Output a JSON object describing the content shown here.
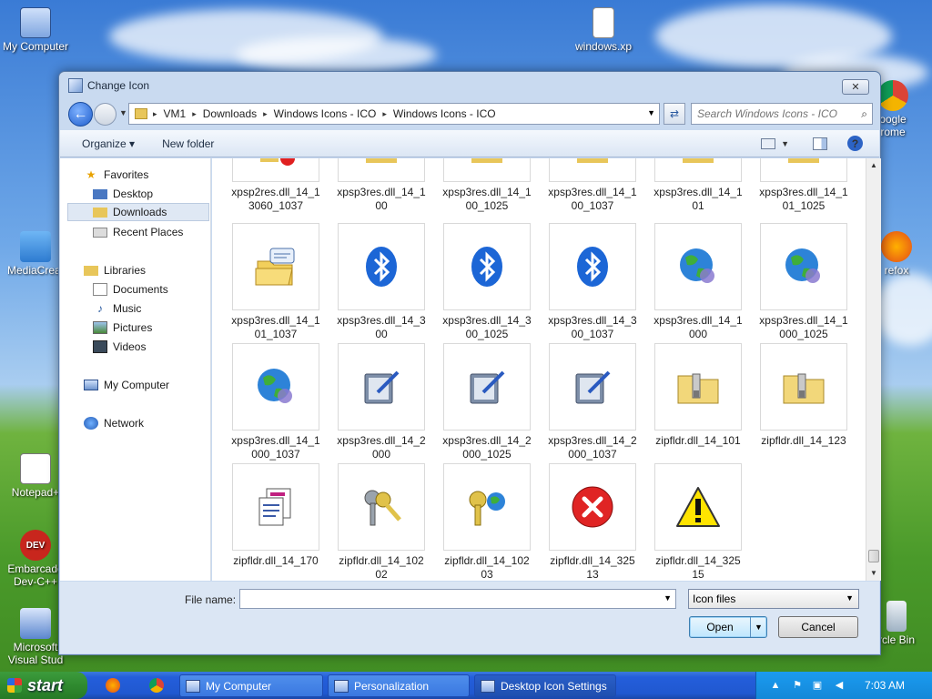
{
  "desktop": {
    "icons": [
      {
        "name": "my-computer",
        "label": "My Computer"
      },
      {
        "name": "windows-xp",
        "label": "windows.xp"
      },
      {
        "name": "google-chrome",
        "label_line1": "oogle",
        "label_line2": "rome"
      },
      {
        "name": "mediacreation",
        "label": "MediaCreat"
      },
      {
        "name": "firefox",
        "label": "refox"
      },
      {
        "name": "notepad",
        "label": "Notepad+"
      },
      {
        "name": "embarcadero",
        "label_line1": "Embarcade",
        "label_line2": "Dev-C++",
        "badge": "DEV"
      },
      {
        "name": "visual-studio",
        "label_line1": "Microsoft",
        "label_line2": "Visual Stud"
      },
      {
        "name": "recycle-bin",
        "label": "rcle Bin"
      }
    ]
  },
  "dialog": {
    "title": "Change Icon",
    "close_glyph": "✕",
    "breadcrumb": [
      "VM1",
      "Downloads",
      "Windows Icons - ICO",
      "Windows Icons - ICO"
    ],
    "search_placeholder": "Search Windows Icons - ICO",
    "toolbar": {
      "organize": "Organize ▾",
      "new_folder": "New folder",
      "help": "?"
    },
    "nav": {
      "favorites": "Favorites",
      "desktop": "Desktop",
      "downloads": "Downloads",
      "recent": "Recent Places",
      "libraries": "Libraries",
      "documents": "Documents",
      "music": "Music",
      "pictures": "Pictures",
      "videos": "Videos",
      "my_computer": "My Computer",
      "network": "Network"
    },
    "files_row0": [
      {
        "name": "xpsp2res.dll_14_13060_1037",
        "lines": [
          "xpsp2res.dll_14_1",
          "3060_1037"
        ]
      },
      {
        "name": "xpsp3res.dll_14_100",
        "lines": [
          "xpsp3res.dll_14_1",
          "00"
        ]
      },
      {
        "name": "xpsp3res.dll_14_100_1025",
        "lines": [
          "xpsp3res.dll_14_1",
          "00_1025"
        ]
      },
      {
        "name": "xpsp3res.dll_14_100_1037",
        "lines": [
          "xpsp3res.dll_14_1",
          "00_1037"
        ]
      },
      {
        "name": "xpsp3res.dll_14_101",
        "lines": [
          "xpsp3res.dll_14_1",
          "01"
        ]
      },
      {
        "name": "xpsp3res.dll_14_101_1025",
        "lines": [
          "xpsp3res.dll_14_1",
          "01_1025"
        ]
      }
    ],
    "files_row1": [
      {
        "lines": [
          "xpsp3res.dll_14_1",
          "01_1037"
        ],
        "icon": "folder-chat-icon"
      },
      {
        "lines": [
          "xpsp3res.dll_14_3",
          "00"
        ],
        "icon": "bluetooth-icon"
      },
      {
        "lines": [
          "xpsp3res.dll_14_3",
          "00_1025"
        ],
        "icon": "bluetooth-icon"
      },
      {
        "lines": [
          "xpsp3res.dll_14_3",
          "00_1037"
        ],
        "icon": "bluetooth-icon"
      },
      {
        "lines": [
          "xpsp3res.dll_14_1",
          "000"
        ],
        "icon": "globe-network-icon"
      },
      {
        "lines": [
          "xpsp3res.dll_14_1",
          "000_1025"
        ],
        "icon": "globe-network-icon"
      }
    ],
    "files_row2": [
      {
        "lines": [
          "xpsp3res.dll_14_1",
          "000_1037"
        ],
        "icon": "globe-network-icon"
      },
      {
        "lines": [
          "xpsp3res.dll_14_2",
          "000"
        ],
        "icon": "tablet-pen-icon"
      },
      {
        "lines": [
          "xpsp3res.dll_14_2",
          "000_1025"
        ],
        "icon": "tablet-pen-icon"
      },
      {
        "lines": [
          "xpsp3res.dll_14_2",
          "000_1037"
        ],
        "icon": "tablet-pen-icon"
      },
      {
        "lines": [
          "zipfldr.dll_14_101",
          ""
        ],
        "icon": "zip-folder-icon"
      },
      {
        "lines": [
          "zipfldr.dll_14_123",
          ""
        ],
        "icon": "zip-folder-icon"
      }
    ],
    "files_row3": [
      {
        "lines": [
          "zipfldr.dll_14_170",
          ""
        ],
        "icon": "document-copy-icon"
      },
      {
        "lines": [
          "zipfldr.dll_14_102",
          "02"
        ],
        "icon": "keys-icon"
      },
      {
        "lines": [
          "zipfldr.dll_14_102",
          "03"
        ],
        "icon": "key-globe-icon"
      },
      {
        "lines": [
          "zipfldr.dll_14_325",
          "13"
        ],
        "icon": "error-icon"
      },
      {
        "lines": [
          "zipfldr.dll_14_325",
          "15"
        ],
        "icon": "warning-icon"
      }
    ],
    "filename_label": "File name:",
    "filename_value": "",
    "filetype": "Icon files",
    "open_label": "Open",
    "cancel_label": "Cancel"
  },
  "taskbar": {
    "start": "start",
    "tasks": [
      "My Computer",
      "Personalization",
      "Desktop Icon Settings"
    ],
    "clock": "7:03 AM"
  }
}
